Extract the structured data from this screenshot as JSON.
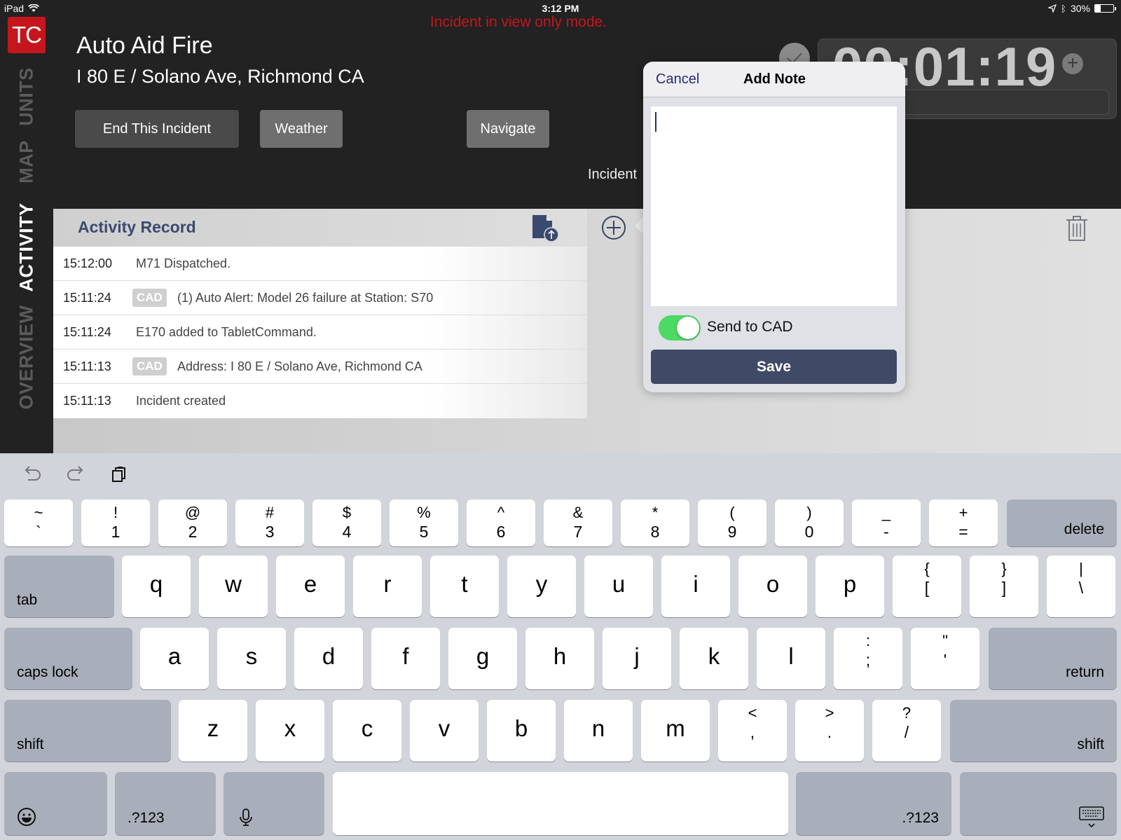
{
  "status_bar": {
    "device": "iPad",
    "time": "3:12 PM",
    "battery_percent_label": "30%",
    "battery_level": 0.3
  },
  "banner": {
    "view_only_message": "Incident in view only mode."
  },
  "app": {
    "logo_text": "TC"
  },
  "side_nav": {
    "tabs": [
      {
        "label": "UNITS",
        "active": false
      },
      {
        "label": "MAP",
        "active": false
      },
      {
        "label": "ACTIVITY",
        "active": true
      },
      {
        "label": "OVERVIEW",
        "active": false
      }
    ]
  },
  "incident": {
    "title": "Auto Aid Fire",
    "address": "I 80 E / Solano Ave, Richmond CA",
    "label_partial": "Incident"
  },
  "header_buttons": {
    "end": "End This Incident",
    "weather": "Weather",
    "navigate": "Navigate"
  },
  "timer": {
    "elapsed": "00:01:19"
  },
  "activity": {
    "title": "Activity Record",
    "rows": [
      {
        "time": "15:12:00",
        "badge": "",
        "text": "M71 Dispatched."
      },
      {
        "time": "15:11:24",
        "badge": "CAD",
        "text": "(1) Auto Alert: Model 26 failure at Station: S70"
      },
      {
        "time": "15:11:24",
        "badge": "",
        "text": "E170 added to TabletCommand."
      },
      {
        "time": "15:11:13",
        "badge": "CAD",
        "text": "Address: I 80 E / Solano Ave, Richmond CA"
      },
      {
        "time": "15:11:13",
        "badge": "",
        "text": "Incident created"
      }
    ]
  },
  "add_note": {
    "cancel": "Cancel",
    "title": "Add Note",
    "note_value": "",
    "send_to_cad_label": "Send to CAD",
    "send_to_cad": true,
    "save": "Save"
  },
  "colors": {
    "brand_red": "#c4161c",
    "accent_navy": "#3e4a66",
    "toggle_on": "#4cd964"
  },
  "keyboard": {
    "row1": [
      {
        "top": "~",
        "bot": "`"
      },
      {
        "top": "!",
        "bot": "1"
      },
      {
        "top": "@",
        "bot": "2"
      },
      {
        "top": "#",
        "bot": "3"
      },
      {
        "top": "$",
        "bot": "4"
      },
      {
        "top": "%",
        "bot": "5"
      },
      {
        "top": "^",
        "bot": "6"
      },
      {
        "top": "&",
        "bot": "7"
      },
      {
        "top": "*",
        "bot": "8"
      },
      {
        "top": "(",
        "bot": "9"
      },
      {
        "top": ")",
        "bot": "0"
      },
      {
        "top": "_",
        "bot": "-"
      },
      {
        "top": "+",
        "bot": "="
      }
    ],
    "delete": "delete",
    "tab": "tab",
    "row2": [
      "q",
      "w",
      "e",
      "r",
      "t",
      "y",
      "u",
      "i",
      "o",
      "p"
    ],
    "row2_sym": [
      {
        "top": "{",
        "bot": "["
      },
      {
        "top": "}",
        "bot": "]"
      },
      {
        "top": "|",
        "bot": "\\"
      }
    ],
    "caps_lock": "caps lock",
    "row3": [
      "a",
      "s",
      "d",
      "f",
      "g",
      "h",
      "j",
      "k",
      "l"
    ],
    "row3_sym": [
      {
        "top": ":",
        "bot": ";"
      },
      {
        "top": "\"",
        "bot": "'"
      }
    ],
    "return": "return",
    "shift": "shift",
    "row4": [
      "z",
      "x",
      "c",
      "v",
      "b",
      "n",
      "m"
    ],
    "row4_sym": [
      {
        "top": "<",
        "bot": ","
      },
      {
        "top": ">",
        "bot": "."
      },
      {
        "top": "?",
        "bot": "/"
      }
    ],
    "numbers": ".?123"
  }
}
